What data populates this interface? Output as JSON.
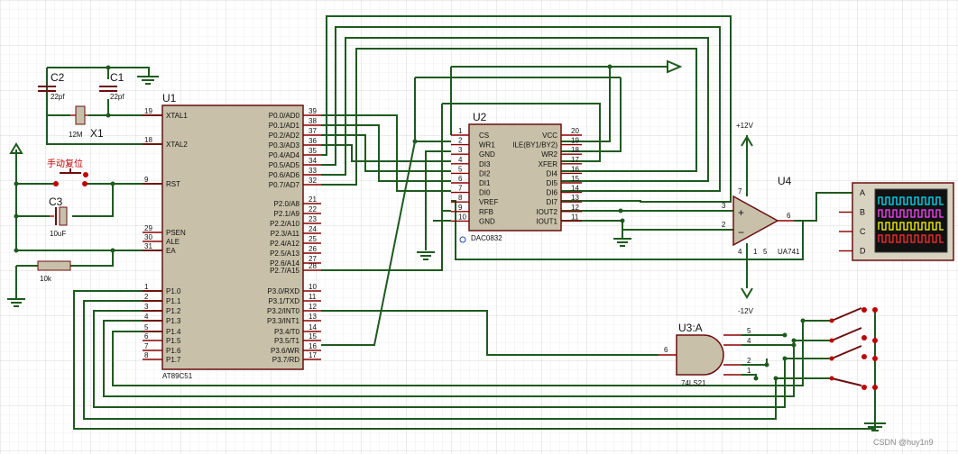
{
  "u1": {
    "ref": "U1",
    "part": "AT89C51",
    "left_pins": [
      {
        "num": "19",
        "name": "XTAL1"
      },
      {
        "num": "18",
        "name": "XTAL2"
      },
      {
        "num": "9",
        "name": "RST"
      },
      {
        "num": "29",
        "name": "PSEN"
      },
      {
        "num": "30",
        "name": "ALE"
      },
      {
        "num": "31",
        "name": "EA"
      },
      {
        "num": "1",
        "name": "P1.0"
      },
      {
        "num": "2",
        "name": "P1.1"
      },
      {
        "num": "3",
        "name": "P1.2"
      },
      {
        "num": "4",
        "name": "P1.3"
      },
      {
        "num": "5",
        "name": "P1.4"
      },
      {
        "num": "6",
        "name": "P1.5"
      },
      {
        "num": "7",
        "name": "P1.6"
      },
      {
        "num": "8",
        "name": "P1.7"
      }
    ],
    "right_pins": [
      {
        "num": "39",
        "name": "P0.0/AD0"
      },
      {
        "num": "38",
        "name": "P0.1/AD1"
      },
      {
        "num": "37",
        "name": "P0.2/AD2"
      },
      {
        "num": "36",
        "name": "P0.3/AD3"
      },
      {
        "num": "35",
        "name": "P0.4/AD4"
      },
      {
        "num": "34",
        "name": "P0.5/AD5"
      },
      {
        "num": "33",
        "name": "P0.6/AD6"
      },
      {
        "num": "32",
        "name": "P0.7/AD7"
      },
      {
        "num": "21",
        "name": "P2.0/A8"
      },
      {
        "num": "22",
        "name": "P2.1/A9"
      },
      {
        "num": "23",
        "name": "P2.2/A10"
      },
      {
        "num": "24",
        "name": "P2.3/A11"
      },
      {
        "num": "25",
        "name": "P2.4/A12"
      },
      {
        "num": "26",
        "name": "P2.5/A13"
      },
      {
        "num": "27",
        "name": "P2.6/A14"
      },
      {
        "num": "28",
        "name": "P2.7/A15"
      },
      {
        "num": "10",
        "name": "P3.0/RXD"
      },
      {
        "num": "11",
        "name": "P3.1/TXD"
      },
      {
        "num": "12",
        "name": "P3.2/INT0"
      },
      {
        "num": "13",
        "name": "P3.3/INT1"
      },
      {
        "num": "14",
        "name": "P3.4/T0"
      },
      {
        "num": "15",
        "name": "P3.5/T1"
      },
      {
        "num": "16",
        "name": "P3.6/WR"
      },
      {
        "num": "17",
        "name": "P3.7/RD"
      }
    ]
  },
  "u2": {
    "ref": "U2",
    "part": "DAC0832",
    "left_pins": [
      {
        "num": "1",
        "name": "CS"
      },
      {
        "num": "2",
        "name": "WR1"
      },
      {
        "num": "3",
        "name": "GND"
      },
      {
        "num": "4",
        "name": "DI3"
      },
      {
        "num": "5",
        "name": "DI2"
      },
      {
        "num": "6",
        "name": "DI1"
      },
      {
        "num": "7",
        "name": "DI0"
      },
      {
        "num": "8",
        "name": "VREF"
      },
      {
        "num": "9",
        "name": "RFB"
      },
      {
        "num": "10",
        "name": "GND"
      }
    ],
    "right_pins": [
      {
        "num": "20",
        "name": "VCC"
      },
      {
        "num": "19",
        "name": "ILE(BY1/BY2)"
      },
      {
        "num": "18",
        "name": "WR2"
      },
      {
        "num": "17",
        "name": "XFER"
      },
      {
        "num": "16",
        "name": "DI4"
      },
      {
        "num": "15",
        "name": "DI5"
      },
      {
        "num": "14",
        "name": "DI6"
      },
      {
        "num": "13",
        "name": "DI7"
      },
      {
        "num": "12",
        "name": "IOUT2"
      },
      {
        "num": "11",
        "name": "IOUT1"
      }
    ]
  },
  "u3": {
    "ref": "U3:A",
    "part": "74LS21",
    "pins": {
      "out": "6",
      "in1": "5",
      "in2": "4",
      "in3": "2",
      "in4": "1"
    }
  },
  "u4": {
    "ref": "U4",
    "part": "UA741",
    "pins": {
      "plus": "3",
      "minus": "2",
      "out": "6",
      "vpos": "7",
      "vneg": "4",
      "offset1": "1",
      "offset5": "5"
    },
    "vpos_label": "+12V",
    "vneg_label": "-12V"
  },
  "components": {
    "c1": {
      "ref": "C1",
      "value": "22pf"
    },
    "c2": {
      "ref": "C2",
      "value": "22pf"
    },
    "c3": {
      "ref": "C3",
      "value": "10uF"
    },
    "x1": {
      "ref": "X1",
      "value": "12M"
    },
    "r1": {
      "value": "10k"
    },
    "reset_button": {
      "label": "手动复位"
    }
  },
  "scope": {
    "channels": [
      "A",
      "B",
      "C",
      "D"
    ],
    "trace_colors": [
      "#00e5ff",
      "#ff44ff",
      "#ffff00",
      "#ff3030"
    ]
  },
  "watermark": "CSDN @huy1n9"
}
